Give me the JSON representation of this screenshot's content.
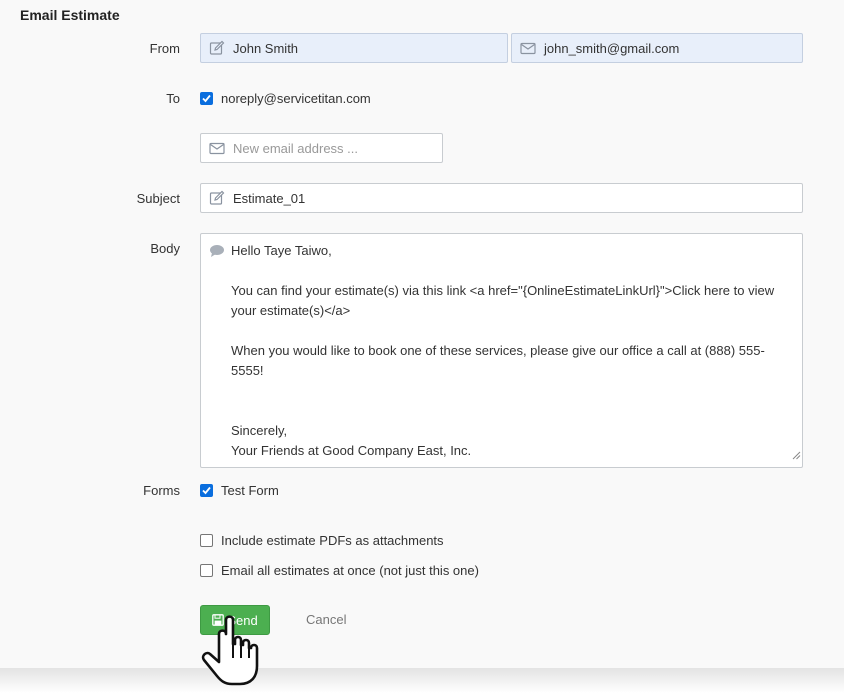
{
  "title": "Email Estimate",
  "from": {
    "label": "From",
    "name": "John Smith",
    "email": "john_smith@gmail.com"
  },
  "to": {
    "label": "To",
    "recipient": "noreply@servicetitan.com",
    "recipient_checked": true,
    "new_email_placeholder": "New email address ..."
  },
  "subject": {
    "label": "Subject",
    "value": "Estimate_01"
  },
  "body": {
    "label": "Body",
    "greeting": "Hello Taye Taiwo,",
    "line1": "You can find your estimate(s) via this link <a href=\"{OnlineEstimateLinkUrl}\">Click here to view",
    "line2": "your estimate(s)</a>",
    "line3": "When you would like to book one of these services, please give our office a call at (888) 555-5555!",
    "closing": "Sincerely,",
    "signature": "Your Friends at Good Company East, Inc."
  },
  "forms": {
    "label": "Forms",
    "items": [
      {
        "label": "Test Form",
        "checked": true
      }
    ]
  },
  "options": [
    {
      "label": "Include estimate PDFs as attachments",
      "checked": false
    },
    {
      "label": "Email all estimates at once (not just this one)",
      "checked": false
    }
  ],
  "actions": {
    "send_label": "Send",
    "cancel_label": "Cancel"
  },
  "colors": {
    "primary_button": "#4caf50",
    "checkbox_checked": "#0a6ede",
    "readonly_field": "#e8effa"
  },
  "icons": {
    "name_field": "edit-icon",
    "email_field": "envelope-icon",
    "subject_field": "edit-icon",
    "body_field": "speech-bubble-icon",
    "send_button": "floppy-disk-icon",
    "cursor": "hand-pointer-icon"
  }
}
